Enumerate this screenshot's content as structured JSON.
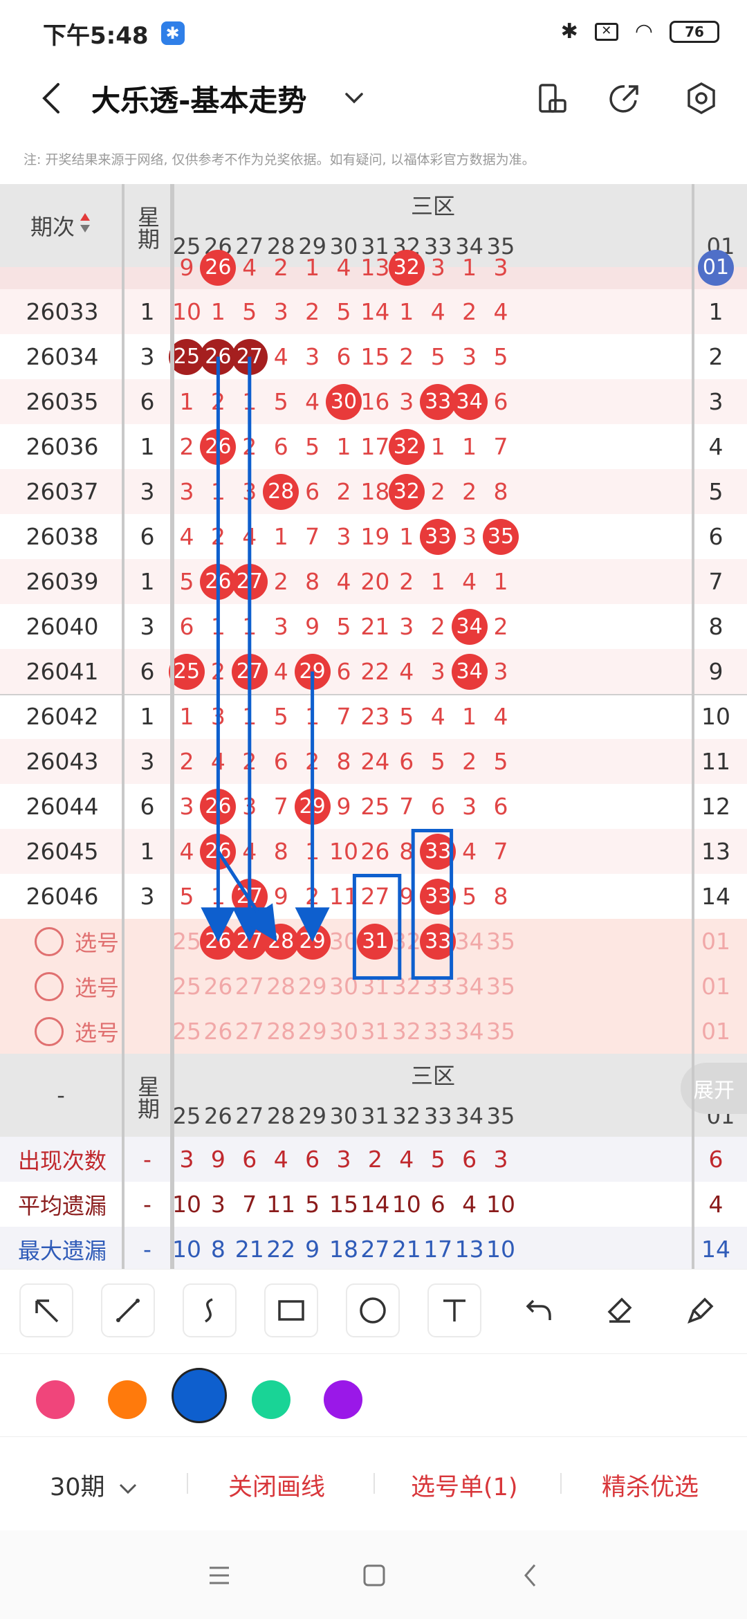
{
  "status_bar": {
    "time": "下午5:48",
    "battery": "76"
  },
  "header": {
    "title": "大乐透-基本走势"
  },
  "note": "注: 开奖结果来源于网络, 仅供参考不作为兑奖依据。如有疑问, 以福体彩官方数据为准。",
  "table": {
    "period_header": "期次",
    "weekday_header": "星期",
    "zone_header": "三区",
    "columns": [
      "25",
      "26",
      "27",
      "28",
      "29",
      "30",
      "31",
      "32",
      "33",
      "34",
      "35",
      "01"
    ],
    "partial_row": {
      "values": [
        "9",
        "26",
        "4",
        "2",
        "1",
        "4",
        "13",
        "32",
        "3",
        "1",
        "3",
        "01"
      ],
      "balls": [
        1,
        7,
        11
      ]
    },
    "rows": [
      {
        "period": "26033",
        "weekday": "1",
        "values": [
          "10",
          "1",
          "5",
          "3",
          "2",
          "5",
          "14",
          "1",
          "4",
          "2",
          "4",
          "1"
        ],
        "balls": []
      },
      {
        "period": "26034",
        "weekday": "3",
        "values": [
          "25",
          "26",
          "27",
          "4",
          "3",
          "6",
          "15",
          "2",
          "5",
          "3",
          "5",
          "2"
        ],
        "balls": [
          0,
          1,
          2
        ],
        "dark": true
      },
      {
        "period": "26035",
        "weekday": "6",
        "values": [
          "1",
          "2",
          "1",
          "5",
          "4",
          "30",
          "16",
          "3",
          "33",
          "34",
          "6",
          "3"
        ],
        "balls": [
          5,
          8,
          9
        ]
      },
      {
        "period": "26036",
        "weekday": "1",
        "values": [
          "2",
          "26",
          "2",
          "6",
          "5",
          "1",
          "17",
          "32",
          "1",
          "1",
          "7",
          "4"
        ],
        "balls": [
          1,
          7
        ]
      },
      {
        "period": "26037",
        "weekday": "3",
        "values": [
          "3",
          "1",
          "3",
          "28",
          "6",
          "2",
          "18",
          "32",
          "2",
          "2",
          "8",
          "5"
        ],
        "balls": [
          3,
          7
        ]
      },
      {
        "period": "26038",
        "weekday": "6",
        "values": [
          "4",
          "2",
          "4",
          "1",
          "7",
          "3",
          "19",
          "1",
          "33",
          "3",
          "35",
          "6"
        ],
        "balls": [
          8,
          10
        ]
      },
      {
        "period": "26039",
        "weekday": "1",
        "values": [
          "5",
          "26",
          "27",
          "2",
          "8",
          "4",
          "20",
          "2",
          "1",
          "4",
          "1",
          "7"
        ],
        "balls": [
          1,
          2
        ]
      },
      {
        "period": "26040",
        "weekday": "3",
        "values": [
          "6",
          "1",
          "1",
          "3",
          "9",
          "5",
          "21",
          "3",
          "2",
          "34",
          "2",
          "8"
        ],
        "balls": [
          9
        ]
      },
      {
        "period": "26041",
        "weekday": "6",
        "values": [
          "25",
          "2",
          "27",
          "4",
          "29",
          "6",
          "22",
          "4",
          "3",
          "34",
          "3",
          "9"
        ],
        "balls": [
          0,
          2,
          4,
          9
        ]
      },
      {
        "period": "26042",
        "weekday": "1",
        "values": [
          "1",
          "3",
          "1",
          "5",
          "1",
          "7",
          "23",
          "5",
          "4",
          "1",
          "4",
          "10"
        ],
        "balls": []
      },
      {
        "period": "26043",
        "weekday": "3",
        "values": [
          "2",
          "4",
          "2",
          "6",
          "2",
          "8",
          "24",
          "6",
          "5",
          "2",
          "5",
          "11"
        ],
        "balls": []
      },
      {
        "period": "26044",
        "weekday": "6",
        "values": [
          "3",
          "26",
          "3",
          "7",
          "29",
          "9",
          "25",
          "7",
          "6",
          "3",
          "6",
          "12"
        ],
        "balls": [
          1,
          4
        ]
      },
      {
        "period": "26045",
        "weekday": "1",
        "values": [
          "4",
          "26",
          "4",
          "8",
          "1",
          "10",
          "26",
          "8",
          "33",
          "4",
          "7",
          "13"
        ],
        "balls": [
          1,
          8
        ]
      },
      {
        "period": "26046",
        "weekday": "3",
        "values": [
          "5",
          "1",
          "27",
          "9",
          "2",
          "11",
          "27",
          "9",
          "33",
          "5",
          "8",
          "14"
        ],
        "balls": [
          2,
          8
        ]
      }
    ],
    "select_label": "选号",
    "select_rows": [
      {
        "values": [
          "25",
          "26",
          "27",
          "28",
          "29",
          "30",
          "31",
          "32",
          "33",
          "34",
          "35",
          "01"
        ],
        "balls": [
          1,
          2,
          3,
          4,
          6,
          8
        ]
      },
      {
        "values": [
          "25",
          "26",
          "27",
          "28",
          "29",
          "30",
          "31",
          "32",
          "33",
          "34",
          "35",
          "01"
        ],
        "balls": []
      },
      {
        "values": [
          "25",
          "26",
          "27",
          "28",
          "29",
          "30",
          "31",
          "32",
          "33",
          "34",
          "35",
          "01"
        ],
        "balls": []
      }
    ],
    "stats_header": "-",
    "stats": [
      {
        "label": "出现次数",
        "dash": "-",
        "values": [
          "3",
          "9",
          "6",
          "4",
          "6",
          "3",
          "2",
          "4",
          "5",
          "6",
          "3",
          "6"
        ],
        "color": "#c0282d"
      },
      {
        "label": "平均遗漏",
        "dash": "-",
        "values": [
          "10",
          "3",
          "7",
          "11",
          "5",
          "15",
          "14",
          "10",
          "6",
          "4",
          "10",
          "4"
        ],
        "color": "#8a1b1b"
      },
      {
        "label": "最大遗漏",
        "dash": "-",
        "values": [
          "10",
          "8",
          "21",
          "22",
          "9",
          "18",
          "27",
          "21",
          "17",
          "13",
          "10",
          "14"
        ],
        "color": "#2f5bb8"
      }
    ],
    "expand_label": "展开"
  },
  "tools": [
    "arrow-tool",
    "line-tool",
    "curve-tool",
    "rectangle-tool",
    "circle-tool",
    "text-tool",
    "undo-tool",
    "eraser-tool",
    "clear-tool"
  ],
  "colors": [
    "#f0457b",
    "#ff7a0c",
    "#0e5fce",
    "#19d496",
    "#9a18e8"
  ],
  "selected_color": 2,
  "bottom_bar": {
    "periods": "30期",
    "close_lines": "关闭画线",
    "selection_list": "选号单(1)",
    "precise": "精杀优选"
  }
}
